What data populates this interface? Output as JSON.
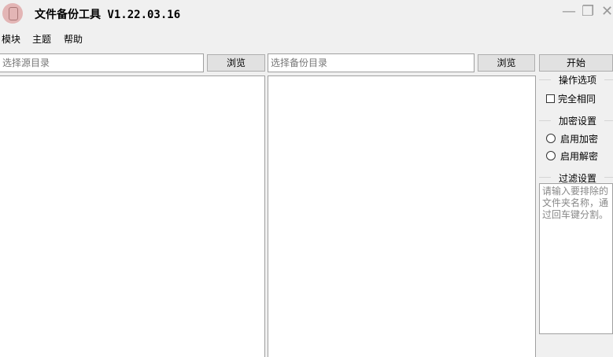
{
  "window": {
    "title": "文件备份工具 V1.22.03.16",
    "logo_icon": "app-logo-icon",
    "minimize_glyph": "—",
    "maximize_glyph": "❐",
    "close_glyph": "✕"
  },
  "menu": {
    "items": [
      {
        "label": "模块"
      },
      {
        "label": "主题"
      },
      {
        "label": "帮助"
      }
    ]
  },
  "source": {
    "placeholder": "选择源目录",
    "browse_label": "浏览"
  },
  "backup": {
    "placeholder": "选择备份目录",
    "browse_label": "浏览"
  },
  "start_label": "开始",
  "options": {
    "title": "操作选项",
    "exact_match_label": "完全相同",
    "exact_match_checked": false
  },
  "encryption": {
    "title": "加密设置",
    "enable_encrypt_label": "启用加密",
    "enable_decrypt_label": "启用解密"
  },
  "filter": {
    "title": "过滤设置",
    "placeholder": "请输入要排除的文件夹名称，通过回车键分割。"
  }
}
